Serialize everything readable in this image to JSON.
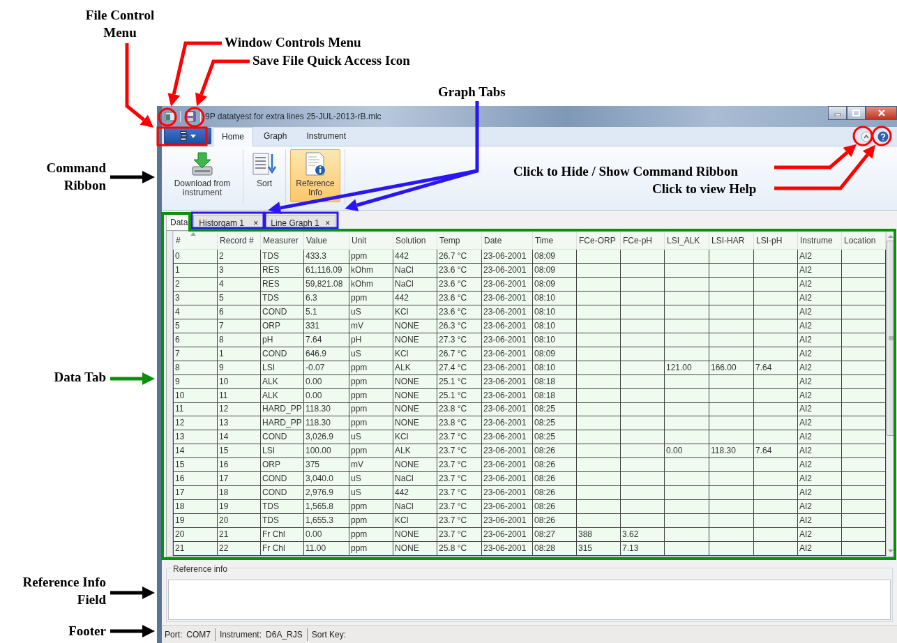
{
  "annotations": [
    {
      "text": "File Control Menu",
      "color": "#ff0000"
    },
    {
      "text": "Window Controls Menu",
      "color": "#ff0000"
    },
    {
      "text": "Save File Quick Access Icon",
      "color": "#ff0000"
    },
    {
      "text": "Graph Tabs",
      "color": "#2a16f2"
    },
    {
      "text": "Command Ribbon",
      "color": "#000000"
    },
    {
      "text": "Click to Hide / Show Command Ribbon",
      "color": "#ff0000"
    },
    {
      "text": "Click to view Help",
      "color": "#ff0000"
    },
    {
      "text": "Data Tab",
      "color": "#0a910a"
    },
    {
      "text": "Reference Info Field",
      "color": "#000000"
    },
    {
      "text": "Footer",
      "color": "#000000"
    }
  ],
  "window": {
    "title": "9P datatyest for extra lines 25-JUL-2013-rB.mlc"
  },
  "ribbon": {
    "tabs": [
      {
        "label": "Home",
        "selected": true
      },
      {
        "label": "Graph",
        "selected": false
      },
      {
        "label": "Instrument",
        "selected": false
      }
    ],
    "buttons": [
      {
        "label": "Download from instrument",
        "kind": "download",
        "selected": false
      },
      {
        "label": "Sort",
        "kind": "sort",
        "selected": false
      },
      {
        "label": "Reference Info",
        "kind": "reference",
        "selected": true
      }
    ]
  },
  "document_tabs": [
    {
      "label": "Data",
      "selected": true
    },
    {
      "label": "Historgam 1",
      "selected": false,
      "close": "×"
    },
    {
      "label": "Line Graph 1",
      "selected": false,
      "close": "×"
    }
  ],
  "table": {
    "columns": [
      "#",
      "Record #",
      "Measurer",
      "Value",
      "Unit",
      "Solution",
      "Temp",
      "Date",
      "Time",
      "FCe-ORP",
      "FCe-pH",
      "LSI_ALK",
      "LSI-HAR",
      "LSI-pH",
      "Instrume",
      "Location"
    ],
    "rows": [
      [
        "0",
        "2",
        "TDS",
        "433.3",
        "ppm",
        "442",
        "26.7 °C",
        "23-06-2001",
        "08:09",
        "",
        "",
        "",
        "",
        "",
        "AI2",
        ""
      ],
      [
        "1",
        "3",
        "RES",
        "61,116.09",
        "kOhm",
        "NaCl",
        "23.6 °C",
        "23-06-2001",
        "08:09",
        "",
        "",
        "",
        "",
        "",
        "AI2",
        ""
      ],
      [
        "2",
        "4",
        "RES",
        "59,821.08",
        "kOhm",
        "NaCl",
        "23.6 °C",
        "23-06-2001",
        "08:09",
        "",
        "",
        "",
        "",
        "",
        "AI2",
        ""
      ],
      [
        "3",
        "5",
        "TDS",
        "6.3",
        "ppm",
        "442",
        "23.6 °C",
        "23-06-2001",
        "08:10",
        "",
        "",
        "",
        "",
        "",
        "AI2",
        ""
      ],
      [
        "4",
        "6",
        "COND",
        "5.1",
        "uS",
        "KCl",
        "23.6 °C",
        "23-06-2001",
        "08:10",
        "",
        "",
        "",
        "",
        "",
        "AI2",
        ""
      ],
      [
        "5",
        "7",
        "ORP",
        "331",
        "mV",
        "NONE",
        "26.3 °C",
        "23-06-2001",
        "08:10",
        "",
        "",
        "",
        "",
        "",
        "AI2",
        ""
      ],
      [
        "6",
        "8",
        "pH",
        "7.64",
        "pH",
        "NONE",
        "27.3 °C",
        "23-06-2001",
        "08:10",
        "",
        "",
        "",
        "",
        "",
        "AI2",
        ""
      ],
      [
        "7",
        "1",
        "COND",
        "646.9",
        "uS",
        "KCl",
        "26.7 °C",
        "23-06-2001",
        "08:09",
        "",
        "",
        "",
        "",
        "",
        "AI2",
        ""
      ],
      [
        "8",
        "9",
        "LSI",
        "-0.07",
        "ppm",
        "ALK",
        "27.4 °C",
        "23-06-2001",
        "08:10",
        "",
        "",
        "121.00",
        "166.00",
        "7.64",
        "AI2",
        ""
      ],
      [
        "9",
        "10",
        "ALK",
        "0.00",
        "ppm",
        "NONE",
        "25.1 °C",
        "23-06-2001",
        "08:18",
        "",
        "",
        "",
        "",
        "",
        "AI2",
        ""
      ],
      [
        "10",
        "11",
        "ALK",
        "0.00",
        "ppm",
        "NONE",
        "25.1 °C",
        "23-06-2001",
        "08:18",
        "",
        "",
        "",
        "",
        "",
        "AI2",
        ""
      ],
      [
        "11",
        "12",
        "HARD_PP",
        "118.30",
        "ppm",
        "NONE",
        "23.8 °C",
        "23-06-2001",
        "08:25",
        "",
        "",
        "",
        "",
        "",
        "AI2",
        ""
      ],
      [
        "12",
        "13",
        "HARD_PP",
        "118.30",
        "ppm",
        "NONE",
        "23.8 °C",
        "23-06-2001",
        "08:25",
        "",
        "",
        "",
        "",
        "",
        "AI2",
        ""
      ],
      [
        "13",
        "14",
        "COND",
        "3,026.9",
        "uS",
        "KCl",
        "23.7 °C",
        "23-06-2001",
        "08:25",
        "",
        "",
        "",
        "",
        "",
        "AI2",
        ""
      ],
      [
        "14",
        "15",
        "LSI",
        "100.00",
        "ppm",
        "ALK",
        "23.7 °C",
        "23-06-2001",
        "08:26",
        "",
        "",
        "0.00",
        "118.30",
        "7.64",
        "AI2",
        ""
      ],
      [
        "15",
        "16",
        "ORP",
        "375",
        "mV",
        "NONE",
        "23.7 °C",
        "23-06-2001",
        "08:26",
        "",
        "",
        "",
        "",
        "",
        "AI2",
        ""
      ],
      [
        "16",
        "17",
        "COND",
        "3,040.0",
        "uS",
        "NaCl",
        "23.7 °C",
        "23-06-2001",
        "08:26",
        "",
        "",
        "",
        "",
        "",
        "AI2",
        ""
      ],
      [
        "17",
        "18",
        "COND",
        "2,976.9",
        "uS",
        "442",
        "23.7 °C",
        "23-06-2001",
        "08:26",
        "",
        "",
        "",
        "",
        "",
        "AI2",
        ""
      ],
      [
        "18",
        "19",
        "TDS",
        "1,565.8",
        "ppm",
        "NaCl",
        "23.7 °C",
        "23-06-2001",
        "08:26",
        "",
        "",
        "",
        "",
        "",
        "AI2",
        ""
      ],
      [
        "19",
        "20",
        "TDS",
        "1,655.3",
        "ppm",
        "KCl",
        "23.7 °C",
        "23-06-2001",
        "08:26",
        "",
        "",
        "",
        "",
        "",
        "AI2",
        ""
      ],
      [
        "20",
        "21",
        "Fr Chl",
        "0.00",
        "ppm",
        "NONE",
        "23.7 °C",
        "23-06-2001",
        "08:27",
        "388",
        "3.62",
        "",
        "",
        "",
        "AI2",
        ""
      ],
      [
        "21",
        "22",
        "Fr Chl",
        "11.00",
        "ppm",
        "NONE",
        "25.8 °C",
        "23-06-2001",
        "08:28",
        "315",
        "7.13",
        "",
        "",
        "",
        "AI2",
        ""
      ]
    ]
  },
  "reference_info": {
    "label": "Reference info"
  },
  "status_bar": [
    {
      "label": "Port:",
      "value": "COM7"
    },
    {
      "label": "Instrument:",
      "value": "D6A_RJS"
    },
    {
      "label": "Sort Key:"
    }
  ]
}
